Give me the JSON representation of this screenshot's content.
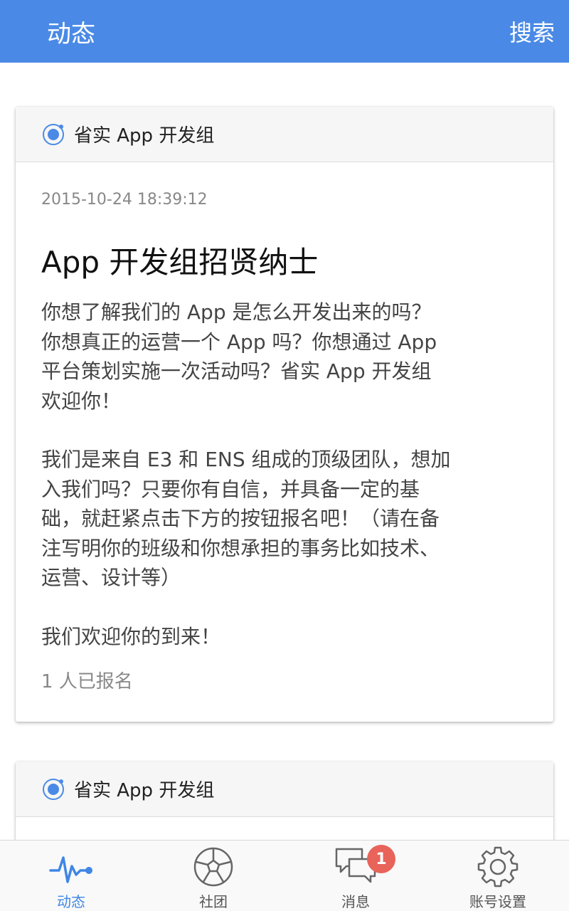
{
  "header": {
    "title": "动态",
    "search_label": "搜索"
  },
  "posts": [
    {
      "group": "省实 App 开发组",
      "timestamp": "2015-10-24 18:39:12",
      "title": "App 开发组招贤纳士",
      "paragraphs": [
        "你想了解我们的 App 是怎么开发出来的吗？\n你想真正的运营一个 App 吗？你想通过 App\n平台策划实施一次活动吗？省实 App 开发组\n欢迎你！",
        "我们是来自 E3 和 ENS 组成的顶级团队，想加\n入我们吗？只要你有自信，并具备一定的基\n础，就赶紧点击下方的按钮报名吧！（请在备\n注写明你的班级和你想承担的事务比如技术、\n运营、设计等）",
        "我们欢迎你的到来！"
      ],
      "signup_count": "1 人已报名"
    },
    {
      "group": "省实 App 开发组"
    }
  ],
  "tabbar": {
    "items": [
      {
        "label": "动态",
        "icon": "pulse-icon"
      },
      {
        "label": "社团",
        "icon": "soccer-ball-icon"
      },
      {
        "label": "消息",
        "icon": "chat-bubbles-icon",
        "badge": "1"
      },
      {
        "label": "账号设置",
        "icon": "gear-icon"
      }
    ]
  },
  "colors": {
    "primary": "#4a8ae6",
    "active_tab": "#3f86e6",
    "badge": "#e8635a"
  }
}
